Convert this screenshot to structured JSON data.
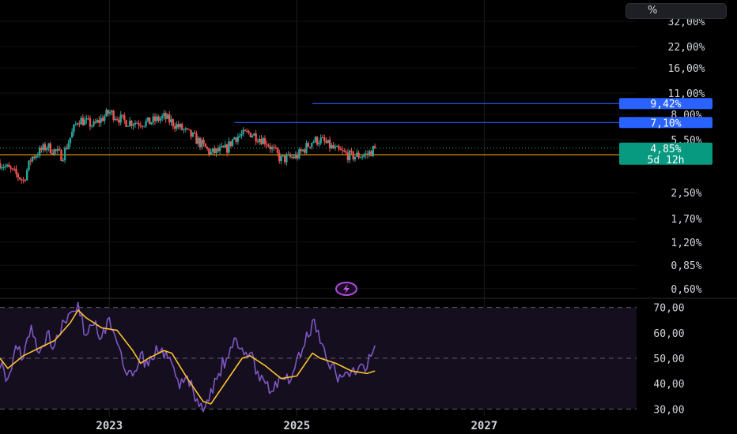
{
  "scale_button": {
    "label": "%"
  },
  "icons": {
    "bolt": "lightning-bolt-icon"
  },
  "colors": {
    "background": "#000000",
    "up": "#26a69a",
    "down": "#ef5350",
    "blue_line": "#2962ff",
    "orange_line": "#f59f00",
    "rsi": "#7e57c2",
    "rsi_ma": "#fbc02d",
    "last_price_label": "#089981",
    "rsi_band": "#140e1f"
  },
  "chart_data": [
    {
      "type": "candlestick",
      "y_scale": "log",
      "ylim": [
        0.52,
        40.0
      ],
      "xlim": [
        "2021-11",
        "2028-08"
      ],
      "x_ticks": [
        "2023",
        "2025",
        "2027"
      ],
      "y_ticks": [
        "32,00%",
        "22,00%",
        "16,00%",
        "11,00%",
        "8,00%",
        "5,50%",
        "2,50%",
        "1,70%",
        "1,20%",
        "0,85%",
        "0,60%"
      ],
      "y_tick_values": [
        32,
        22,
        16,
        11,
        8,
        5.5,
        2.5,
        1.7,
        1.2,
        0.85,
        0.6
      ],
      "grid": true,
      "ohlc_key_points": [
        [
          "2021-11",
          3.9
        ],
        [
          "2022-01",
          3.3
        ],
        [
          "2022-02",
          3.0
        ],
        [
          "2022-03",
          4.2
        ],
        [
          "2022-05",
          5.0
        ],
        [
          "2022-07",
          4.3
        ],
        [
          "2022-09",
          7.5
        ],
        [
          "2022-11",
          6.8
        ],
        [
          "2023-01",
          8.3
        ],
        [
          "2023-03",
          7.2
        ],
        [
          "2023-06",
          7.1
        ],
        [
          "2023-08",
          7.7
        ],
        [
          "2023-10",
          6.6
        ],
        [
          "2023-12",
          5.6
        ],
        [
          "2024-02",
          4.5
        ],
        [
          "2024-04",
          4.8
        ],
        [
          "2024-05",
          5.7
        ],
        [
          "2024-07",
          6.1
        ],
        [
          "2024-09",
          5.4
        ],
        [
          "2024-11",
          4.1
        ],
        [
          "2025-01",
          4.3
        ],
        [
          "2025-03",
          5.4
        ],
        [
          "2025-04",
          5.5
        ],
        [
          "2025-06",
          4.7
        ],
        [
          "2025-08",
          4.3
        ],
        [
          "2025-10",
          4.4
        ],
        [
          "2025-11",
          4.85
        ]
      ],
      "horizontal_lines": [
        {
          "value": 9.42,
          "label": "9,42%",
          "from": "2025-03",
          "color": "blue"
        },
        {
          "value": 7.1,
          "label": "7,10%",
          "from": "2024-05",
          "color": "blue"
        },
        {
          "value": 4.4,
          "from": "2021-11",
          "color": "orange"
        }
      ],
      "last_value": {
        "value": 4.85,
        "label": "4,85%",
        "countdown": "5d 12h"
      }
    },
    {
      "type": "line",
      "panel": "rsi",
      "ylim": [
        27,
        73
      ],
      "y_ticks": [
        "70,00",
        "60,00",
        "50,00",
        "40,00",
        "30,00"
      ],
      "y_tick_values": [
        70,
        60,
        50,
        40,
        30
      ],
      "band": [
        30,
        70
      ],
      "series": [
        {
          "role": "rsi",
          "points": [
            [
              "2021-11",
              46
            ],
            [
              "2021-12",
              42
            ],
            [
              "2022-01",
              55
            ],
            [
              "2022-02",
              50
            ],
            [
              "2022-03",
              63
            ],
            [
              "2022-04",
              52
            ],
            [
              "2022-05",
              60
            ],
            [
              "2022-06",
              55
            ],
            [
              "2022-07",
              65
            ],
            [
              "2022-08",
              68
            ],
            [
              "2022-09",
              72
            ],
            [
              "2022-10",
              59
            ],
            [
              "2022-11",
              63
            ],
            [
              "2022-12",
              58
            ],
            [
              "2023-01",
              66
            ],
            [
              "2023-02",
              56
            ],
            [
              "2023-03",
              45
            ],
            [
              "2023-04",
              43
            ],
            [
              "2023-05",
              52
            ],
            [
              "2023-06",
              47
            ],
            [
              "2023-07",
              55
            ],
            [
              "2023-08",
              50
            ],
            [
              "2023-09",
              48
            ],
            [
              "2023-10",
              38
            ],
            [
              "2023-11",
              43
            ],
            [
              "2023-12",
              33
            ],
            [
              "2024-01",
              29
            ],
            [
              "2024-02",
              38
            ],
            [
              "2024-03",
              44
            ],
            [
              "2024-04",
              50
            ],
            [
              "2024-05",
              58
            ],
            [
              "2024-06",
              54
            ],
            [
              "2024-07",
              52
            ],
            [
              "2024-08",
              45
            ],
            [
              "2024-09",
              40
            ],
            [
              "2024-10",
              37
            ],
            [
              "2024-11",
              42
            ],
            [
              "2024-12",
              40
            ],
            [
              "2025-01",
              50
            ],
            [
              "2025-02",
              55
            ],
            [
              "2025-03",
              65
            ],
            [
              "2025-04",
              56
            ],
            [
              "2025-05",
              48
            ],
            [
              "2025-06",
              44
            ],
            [
              "2025-07",
              43
            ],
            [
              "2025-08",
              45
            ],
            [
              "2025-09",
              47
            ],
            [
              "2025-10",
              46
            ],
            [
              "2025-11",
              55
            ]
          ]
        },
        {
          "role": "rsi_ma",
          "points": [
            [
              "2021-11",
              50
            ],
            [
              "2021-12",
              46
            ],
            [
              "2022-02",
              51
            ],
            [
              "2022-04",
              54
            ],
            [
              "2022-06",
              57
            ],
            [
              "2022-08",
              64
            ],
            [
              "2022-09",
              69
            ],
            [
              "2022-10",
              66
            ],
            [
              "2022-12",
              62
            ],
            [
              "2023-02",
              61
            ],
            [
              "2023-04",
              53
            ],
            [
              "2023-05",
              48
            ],
            [
              "2023-06",
              50
            ],
            [
              "2023-08",
              53
            ],
            [
              "2023-09",
              52
            ],
            [
              "2023-11",
              42
            ],
            [
              "2024-01",
              33
            ],
            [
              "2024-02",
              32
            ],
            [
              "2024-04",
              41
            ],
            [
              "2024-06",
              50
            ],
            [
              "2024-07",
              51
            ],
            [
              "2024-09",
              47
            ],
            [
              "2024-11",
              42
            ],
            [
              "2025-01",
              43
            ],
            [
              "2025-03",
              52
            ],
            [
              "2025-04",
              50
            ],
            [
              "2025-06",
              48
            ],
            [
              "2025-08",
              45
            ],
            [
              "2025-10",
              44
            ],
            [
              "2025-11",
              45
            ]
          ]
        }
      ]
    }
  ]
}
